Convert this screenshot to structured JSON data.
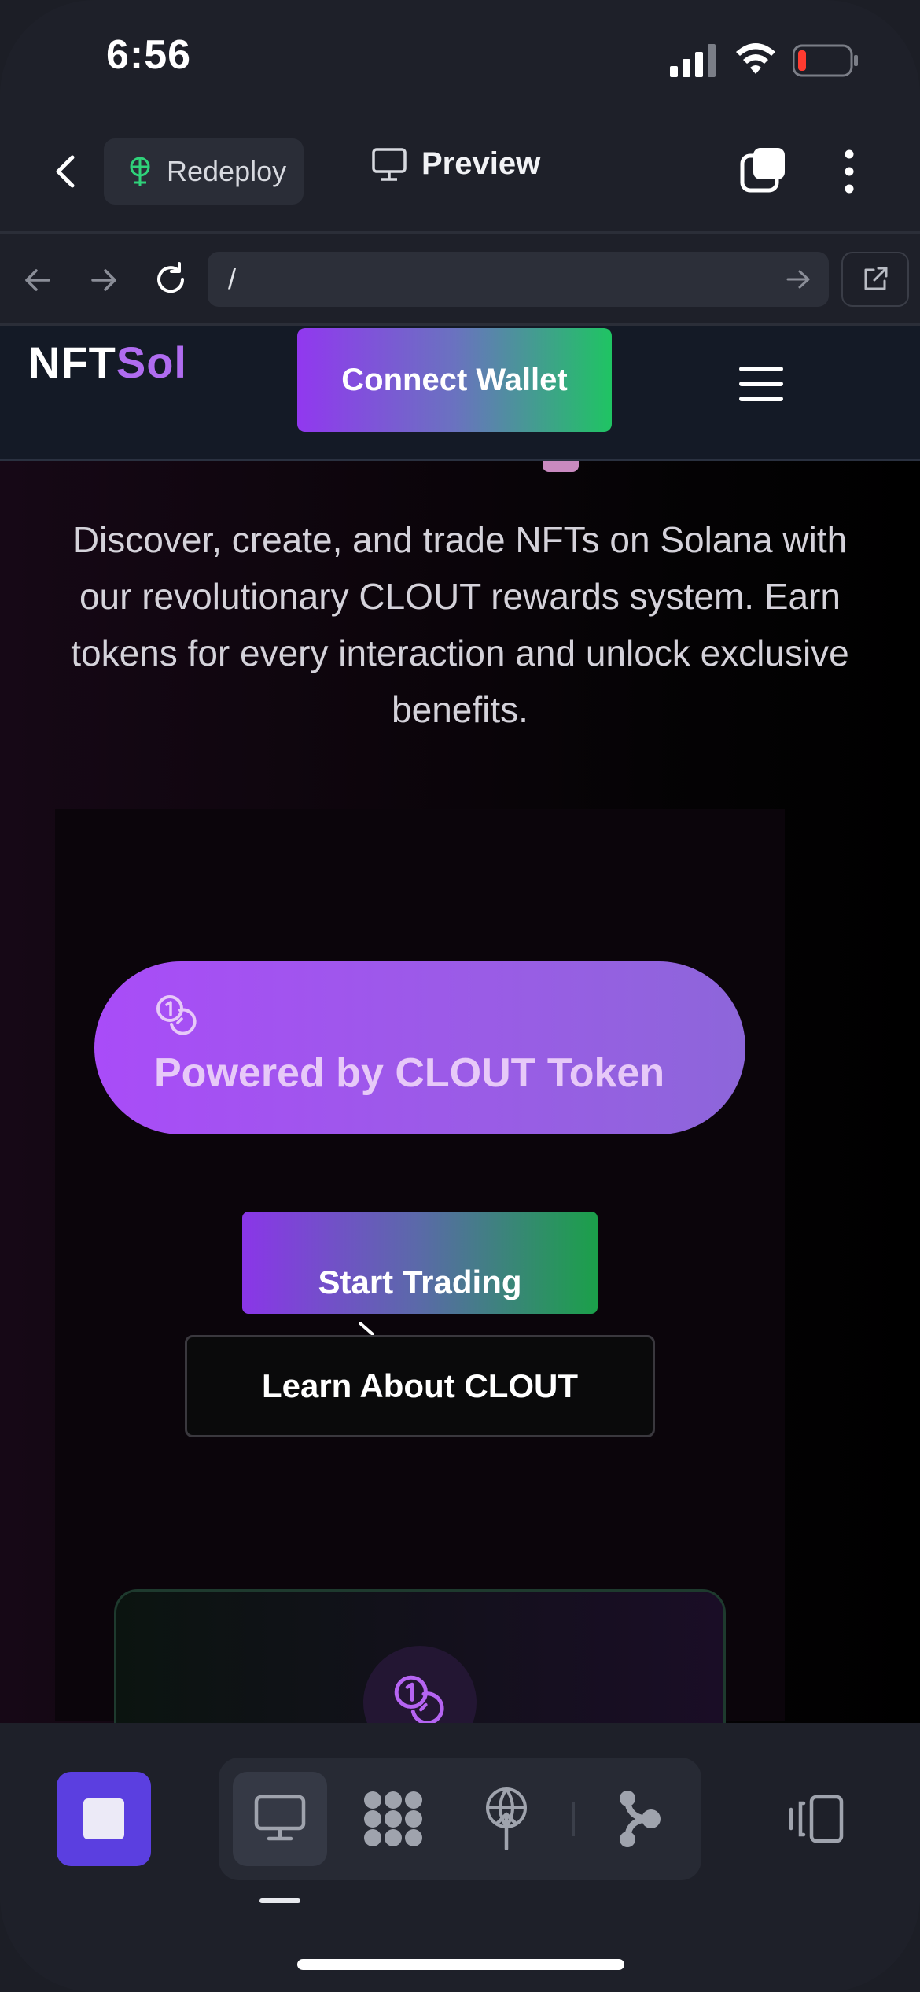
{
  "status_bar": {
    "time": "6:56"
  },
  "app_header": {
    "redeploy_label": "Redeploy",
    "preview_label": "Preview"
  },
  "browser": {
    "url": "/"
  },
  "site": {
    "logo_part1": "NFT",
    "logo_part2": "Sol",
    "connect_wallet": "Connect Wallet",
    "hero_description": "Discover, create, and trade NFTs on Solana with our revolutionary CLOUT rewards system. Earn tokens for every interaction and unlock exclusive benefits.",
    "badge": "Powered by CLOUT Token",
    "start_trading": "Start Trading",
    "learn_clout": "Learn About CLOUT"
  },
  "colors": {
    "accent_purple": "#a94cf8",
    "accent_green": "#1fc463",
    "logo_highlight": "#b06cf0",
    "stop_button": "#5b3fe0"
  },
  "icons": [
    "chevron-left-icon",
    "seedling-icon",
    "monitor-icon",
    "tabs-icon",
    "more-vertical-icon",
    "arrow-left-icon",
    "arrow-right-icon",
    "reload-icon",
    "external-link-icon",
    "menu-icon",
    "coins-icon",
    "stop-icon",
    "grid-icon",
    "deploy-icon",
    "branch-icon",
    "panel-icon"
  ]
}
